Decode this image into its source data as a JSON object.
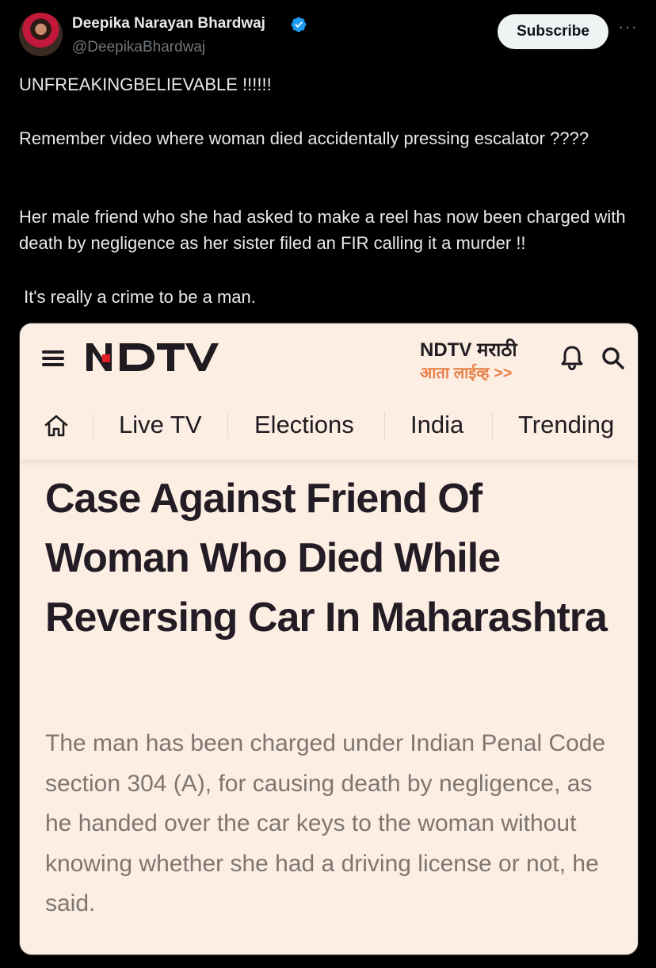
{
  "tweet": {
    "author_name": "Deepika Narayan Bhardwaj",
    "author_handle": "@DeepikaBhardwaj",
    "subscribe_label": "Subscribe",
    "more_label": "···",
    "paragraphs": [
      "UNFREAKINGBELIEVABLE !!!!!!",
      "Remember video where woman died accidentally pressing escalator ????",
      "Her male friend who she had asked to make a reel has now been charged with death by negligence as her sister filed an FIR calling it a murder !!",
      " It's really a crime to be a man."
    ]
  },
  "card": {
    "brand": "NDTV",
    "marathi_title": "NDTV मराठी",
    "marathi_live": "आता लाईव्ह >>",
    "nav_items": [
      "Live TV",
      "Elections",
      "India",
      "Trending"
    ],
    "headline": "Case Against Friend Of Woman Who Died While Reversing Car In Maharashtra",
    "summary": "The man has been charged under Indian Penal Code section 304 (A), for causing death by negligence, as he handed over the car keys to the woman without knowing whether she had a driving license or not, he said."
  },
  "colors": {
    "background": "#000000",
    "card_background": "#fdeee3",
    "verified": "#1d9bf0",
    "ndtv_red": "#e31e24",
    "marathi_orange": "#e8804a"
  }
}
